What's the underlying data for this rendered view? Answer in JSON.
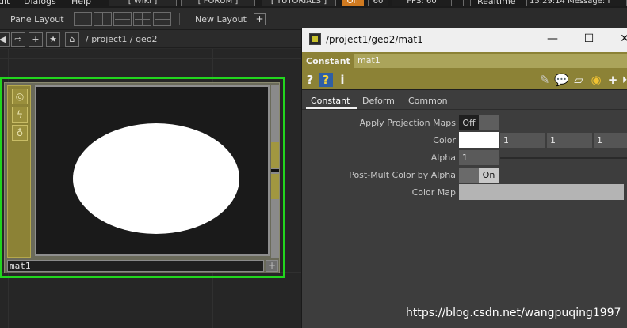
{
  "menubar": {
    "items": [
      "dit",
      "Dialogs",
      "Help"
    ],
    "wiki": "[ WIKI ]",
    "forum": "[ FORUM ]",
    "tutorials": "[ TUTORIALS ]",
    "off": "Off",
    "sixty": "60",
    "fps": "FPS: 60",
    "realtime": "Realtime",
    "clock_message": "15:29:14 Message: I"
  },
  "panebar": {
    "pane_layout_label": "Pane Layout",
    "new_layout_label": "New Layout",
    "add_button": "+"
  },
  "pathbar": {
    "left_arrow": "◀",
    "right_arrow": "⇨",
    "plus": "+",
    "star": "★",
    "home": "⌂",
    "path": "/ project1 / geo2"
  },
  "node": {
    "name": "mat1",
    "flags": [
      "◎",
      "ϟ",
      "♁"
    ],
    "plus": "+"
  },
  "param": {
    "window_title": "/project1/geo2/mat1",
    "window_buttons": {
      "minimize": "—",
      "maximize": "☐",
      "close": "✕"
    },
    "type_label": "Constant",
    "node_name": "mat1",
    "icons_left": [
      "?",
      "?",
      "i"
    ],
    "icons_right": [
      "✎",
      "💬",
      "▱",
      "◉",
      "+",
      "⏵"
    ],
    "tabs": [
      "Constant",
      "Deform",
      "Common"
    ],
    "params": {
      "apply_projection_maps": {
        "label": "Apply Projection Maps",
        "value": "Off"
      },
      "color": {
        "label": "Color",
        "r": "1",
        "g": "1",
        "b": "1"
      },
      "alpha": {
        "label": "Alpha",
        "value": "1"
      },
      "post_mult": {
        "label": "Post-Mult Color by Alpha",
        "value": "On"
      },
      "color_map": {
        "label": "Color Map",
        "value": ""
      }
    },
    "colors": {
      "accent": "#8c8236",
      "selected_outline": "#22d61e"
    }
  },
  "watermark": "https://blog.csdn.net/wangpuqing1997"
}
